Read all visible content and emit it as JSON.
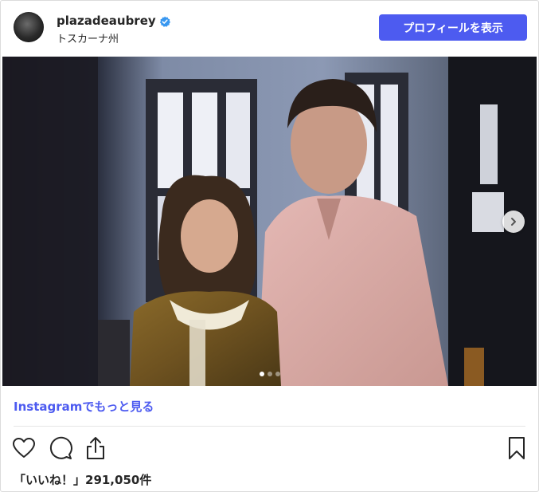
{
  "header": {
    "username": "plazadeaubrey",
    "location": "トスカーナ州",
    "profile_button_label": "プロフィールを表示"
  },
  "post": {
    "carousel": {
      "slide_count": 3,
      "active_slide": 1
    }
  },
  "footer": {
    "more_link_label": "Instagramでもっと見る",
    "likes_text": "「いいね！」291,050件"
  },
  "icons": {
    "verified": "verified-badge-icon",
    "next": "chevron-right-icon",
    "like": "heart-icon",
    "comment": "comment-icon",
    "share": "share-icon",
    "save": "bookmark-icon"
  },
  "colors": {
    "accent": "#4d5bf0",
    "verified": "#3897f0",
    "text": "#262626",
    "border": "#dbdbdb"
  }
}
